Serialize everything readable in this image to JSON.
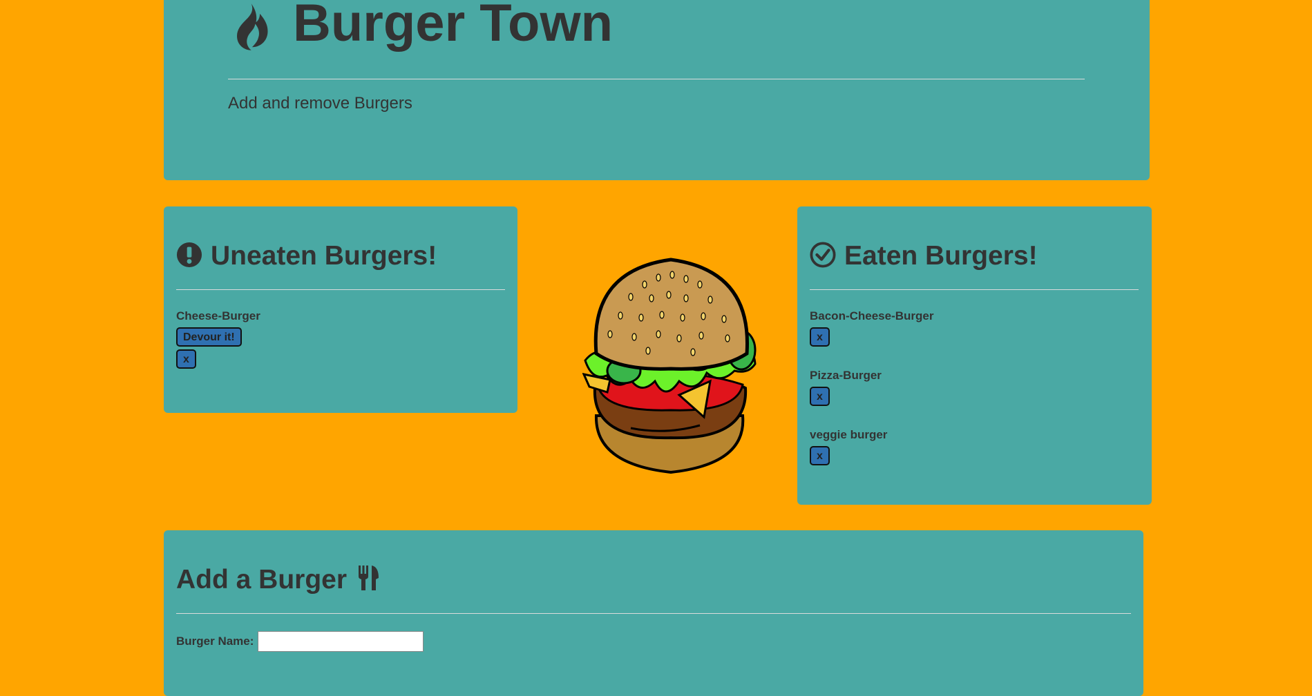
{
  "header": {
    "title": "Burger Town",
    "subtitle": "Add and remove Burgers",
    "icon": "fire-icon"
  },
  "uneaten": {
    "title": "Uneaten Burgers!",
    "icon": "exclamation-circle-icon",
    "items": [
      {
        "name": "Cheese-Burger",
        "devour_label": "Devour it!",
        "delete_label": "x"
      }
    ]
  },
  "eaten": {
    "title": "Eaten Burgers!",
    "icon": "check-circle-icon",
    "items": [
      {
        "name": "Bacon-Cheese-Burger",
        "delete_label": "x"
      },
      {
        "name": "Pizza-Burger",
        "delete_label": "x"
      },
      {
        "name": "veggie burger",
        "delete_label": "x"
      }
    ]
  },
  "add": {
    "title": "Add a Burger",
    "icon": "cutlery-icon",
    "name_label": "Burger Name:",
    "name_value": "",
    "name_placeholder": ""
  },
  "image": {
    "name": "burger-illustration"
  },
  "colors": {
    "background": "#ffa500",
    "panel": "#4aa9a4",
    "button": "#2f70b1",
    "text": "#333333"
  }
}
